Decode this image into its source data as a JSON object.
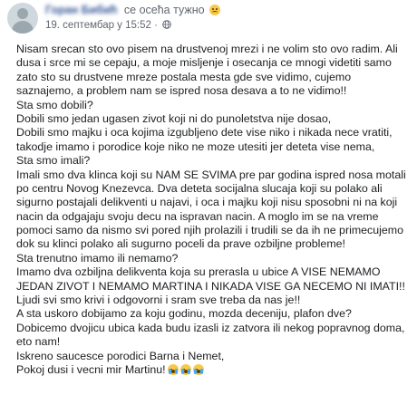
{
  "post": {
    "author": "Горан Бибић",
    "feeling": "се осећа тужно",
    "feeling_icon": "sad-face-emoji",
    "date": "19. септембар у 15:52",
    "separator": "·",
    "privacy_icon": "globe-icon",
    "lines": [
      "Nisam srecan sto ovo pisem na drustvenoj mrezi i ne volim sto ovo radim. Ali",
      "dusa i srce mi se cepaju, a moje misljenje i osecanja ce mnogi videtiti samo",
      "zato sto su drustvene mreze postala mesta gde sve vidimo, cujemo",
      "saznajemo, a problem nam se ispred nosa desava a to ne vidimo!!",
      "Sta smo dobili?",
      "Dobili smo jedan ugasen zivot koji ni do punoletstva nije dosao,",
      "Dobili smo majku i oca kojima izgubljeno dete vise niko i nikada nece vratiti,",
      "takodje imamo i porodice koje niko ne moze utesiti jer deteta vise nema,",
      "Sta smo imali?",
      "Imali smo dva klinca koji su NAM SE SVIMA pre par godina ispred nosa motali",
      "po centru Novog Knezevca. Dva deteta socijalna slucaja koji su polako ali",
      "sigurno postajali delikventi u najavi, i oca i majku koji nisu sposobni ni na koji",
      "nacin da odgajaju svoju decu na ispravan nacin. A moglo im se na vreme",
      "pomoci samo da nismo svi pored njih prolazili i trudili se da ih ne primecujemo",
      "dok su klinci polako ali sugurno poceli da prave ozbiljne probleme!",
      "Sta trenutno imamo ili nemamo?",
      "Imamo dva ozbiljna delikventa koja su prerasla u ubice A VISE NEMAMO",
      "JEDAN ZIVOT I NEMAMO MARTINA I NIKADA VISE GA NECEMO NI IMATI!!",
      "Ljudi svi smo krivi i odgovorni i sram sve treba da nas je!!",
      "A sta uskoro dobijamo za koju godinu, mozda deceniju, plafon dve?",
      "Dobicemo dvojicu ubica kada budu izasli iz zatvora ili nekog popravnog doma,",
      "eto nam!",
      "Iskreno saucesce porodici Barna i Nemet,",
      "Pokoj dusi i vecni mir Martinu!"
    ],
    "closing_icons": [
      "crying-face-emoji",
      "crying-face-emoji",
      "crying-face-emoji"
    ]
  }
}
